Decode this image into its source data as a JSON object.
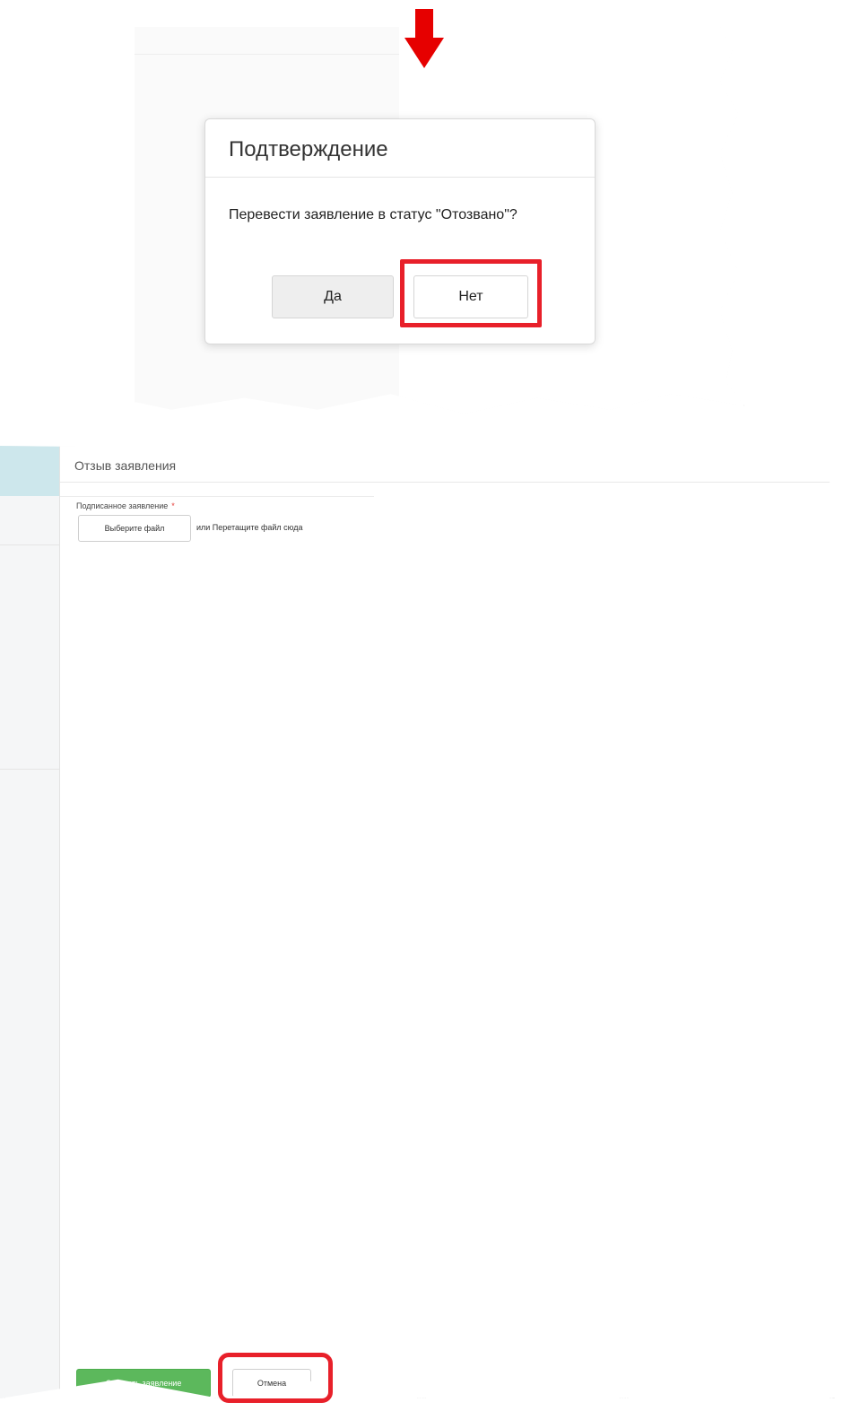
{
  "confirm_dialog": {
    "title": "Подтверждение",
    "message": "Перевести заявление в статус \"Отозвано\"?",
    "yes_label": "Да",
    "no_label": "Нет"
  },
  "withdraw_panel": {
    "title": "Отзыв заявления",
    "field_label": "Подписанное заявление",
    "required_mark": "*",
    "choose_file_label": "Выберите файл",
    "drop_hint": "или Перетащите файл сюда",
    "submit_label": "Отозвать заявление",
    "cancel_label": "Отмена"
  },
  "annotations": {
    "arrow_color": "#e60000",
    "highlight_color": "#e8202a"
  },
  "colors": {
    "primary_green": "#5cb85c",
    "sidebar_accent": "#cde7ec"
  }
}
